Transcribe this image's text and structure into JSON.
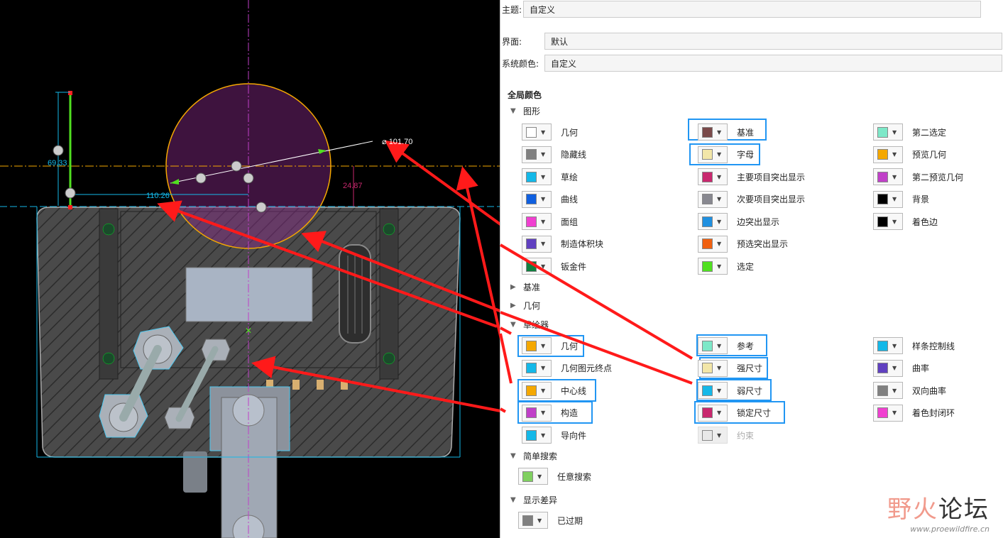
{
  "cad": {
    "dims": {
      "diameter": "101.70",
      "horizontal": "110.26",
      "vertical_left": "69.33",
      "vertical_right": "24.87"
    }
  },
  "panel": {
    "fields": [
      {
        "label": "主题:",
        "value": "自定义"
      },
      {
        "label": "界面:",
        "value": "默认"
      },
      {
        "label": "系统颜色:",
        "value": "自定义"
      }
    ],
    "global_title": "全局颜色",
    "sections": {
      "graphics": "图形",
      "datum": "基准",
      "geometry": "几何",
      "sketcher": "草绘器",
      "simple_search": "简单搜索",
      "show_diff": "显示差异"
    },
    "graphics_items": [
      {
        "label": "几何",
        "color": "#ffffff"
      },
      {
        "label": "基准",
        "color": "#7a4a4a"
      },
      {
        "label": "第二选定",
        "color": "#7de8c8"
      },
      {
        "label": "隐藏线",
        "color": "#808080"
      },
      {
        "label": "字母",
        "color": "#f2e6a8"
      },
      {
        "label": "预览几何",
        "color": "#f5a800"
      },
      {
        "label": "草绘",
        "color": "#14b8e8"
      },
      {
        "label": "主要项目突出显示",
        "color": "#c8286e"
      },
      {
        "label": "第二预览几何",
        "color": "#c040c8"
      },
      {
        "label": "曲线",
        "color": "#1060e0"
      },
      {
        "label": "次要项目突出显示",
        "color": "#888890"
      },
      {
        "label": "背景",
        "color": "#000000"
      },
      {
        "label": "面组",
        "color": "#f040d0"
      },
      {
        "label": "边突出显示",
        "color": "#2090e0"
      },
      {
        "label": "着色边",
        "color": "#000000"
      },
      {
        "label": "制造体积块",
        "color": "#6040c0"
      },
      {
        "label": "预选突出显示",
        "color": "#f06010"
      },
      {
        "label": "钣金件",
        "color": "#108040"
      },
      {
        "label": "选定",
        "color": "#50e020"
      }
    ],
    "sketcher_items": [
      {
        "label": "几何",
        "color": "#f5a800"
      },
      {
        "label": "参考",
        "color": "#7de8c8"
      },
      {
        "label": "样条控制线",
        "color": "#14b8e8"
      },
      {
        "label": "几何图元终点",
        "color": "#14b8e8"
      },
      {
        "label": "强尺寸",
        "color": "#f2e6a8"
      },
      {
        "label": "曲率",
        "color": "#6040c0"
      },
      {
        "label": "中心线",
        "color": "#f5a800"
      },
      {
        "label": "弱尺寸",
        "color": "#14b8e8"
      },
      {
        "label": "双向曲率",
        "color": "#808080"
      },
      {
        "label": "构造",
        "color": "#c040c8"
      },
      {
        "label": "锁定尺寸",
        "color": "#c8286e"
      },
      {
        "label": "着色封闭环",
        "color": "#f040d0"
      },
      {
        "label": "导向件",
        "color": "#14b8e8"
      },
      {
        "label": "约束",
        "color": "#e8e8e8"
      }
    ],
    "search_items": [
      {
        "label": "任意搜索",
        "color": "#80d060"
      }
    ],
    "diff_items": [
      {
        "label": "已过期",
        "color": "#808080"
      }
    ]
  },
  "watermark": {
    "cn_a": "野火",
    "cn_b": "论坛",
    "url": "www.proewildfire.cn"
  }
}
